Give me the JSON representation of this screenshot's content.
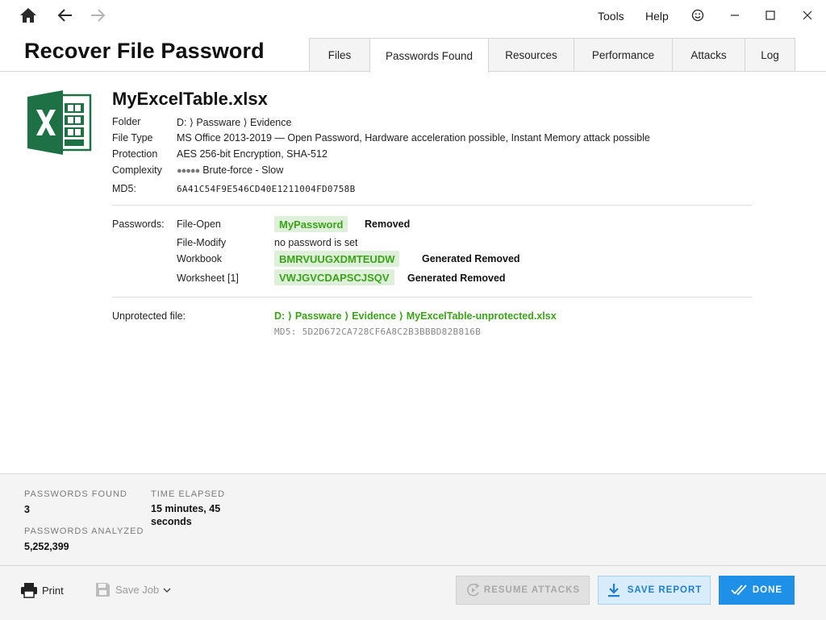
{
  "nav": {
    "home_icon": "home-icon",
    "back_icon": "arrow-left-icon",
    "forward_icon": "arrow-right-icon"
  },
  "menu": {
    "tools": "Tools",
    "help": "Help",
    "feedback_icon": "smiley-icon"
  },
  "app_title": "Recover File Password",
  "tabs": [
    {
      "label": "Files"
    },
    {
      "label": "Passwords Found",
      "active": true
    },
    {
      "label": "Resources"
    },
    {
      "label": "Performance"
    },
    {
      "label": "Attacks"
    },
    {
      "label": "Log"
    }
  ],
  "file": {
    "name": "MyExcelTable.xlsx",
    "icon": "excel-file-icon",
    "labels": {
      "folder": "Folder",
      "type": "File Type",
      "protection": "Protection",
      "complexity": "Complexity",
      "md5": "MD5:"
    },
    "folder": "D: ⟩ Passware ⟩ Evidence",
    "type": "MS Office 2013-2019 — Open Password, Hardware acceleration possible, Instant Memory attack possible",
    "protection": "AES 256-bit Encryption, SHA-512",
    "complexity_dots": "●●●●●",
    "complexity": "Brute-force - Slow",
    "md5": "6A41C54F9E546CD40E1211004FD0758B"
  },
  "passwords": {
    "label": "Passwords:",
    "rows": [
      {
        "name": "File-Open",
        "value": "MyPassword",
        "status": "Removed"
      },
      {
        "name": "File-Modify",
        "value": "no password is set"
      },
      {
        "name": "Workbook",
        "value": "BMRVUUGXDMTEUDW",
        "status": "Generated Removed"
      },
      {
        "name": "Worksheet [1]",
        "value": "VWJGVCDAPSCJSQV",
        "status": "Generated Removed"
      }
    ]
  },
  "unprotected": {
    "label": "Unprotected file:",
    "path": "D: ⟩ Passware ⟩ Evidence ⟩ MyExcelTable-unprotected.xlsx",
    "md5": "MD5: 5D2D672CA728CF6A8C2B3BBBD82B816B"
  },
  "stats": {
    "found_label": "PASSWORDS FOUND",
    "found": "3",
    "elapsed_label": "TIME ELAPSED",
    "elapsed_line1": "15 minutes, 45",
    "elapsed_line2": "seconds",
    "analyzed_label": "PASSWORDS ANALYZED",
    "analyzed": "5,252,399"
  },
  "bottom": {
    "print": "Print",
    "save_job": "Save Job",
    "resume": "RESUME ATTACKS",
    "save_report": "SAVE REPORT",
    "done": "DONE"
  },
  "colors": {
    "accent_blue": "#1e90e8",
    "password_green": "#3aa318",
    "excel_green": "#1e7145"
  }
}
